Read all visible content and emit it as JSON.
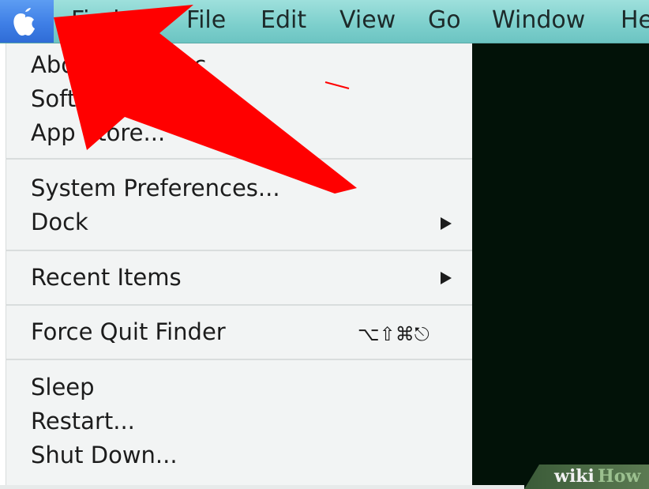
{
  "menubar": {
    "apple_icon": "apple-logo-icon",
    "items": [
      "Finder",
      "File",
      "Edit",
      "View",
      "Go",
      "Window",
      "He"
    ]
  },
  "dropdown": {
    "group1": [
      "About This Mac",
      "Software Update...",
      "App Store..."
    ],
    "group2": [
      "System Preferences...",
      "Dock"
    ],
    "group3": [
      "Recent Items"
    ],
    "group4": [
      "Force Quit Finder"
    ],
    "force_quit_shortcut": "⌥⇧⌘⎋",
    "group5": [
      "Sleep",
      "Restart...",
      "Shut Down..."
    ],
    "submenu_icon": "submenu-arrow-icon"
  },
  "annotation": {
    "arrow_color": "#ff0000",
    "points_to": "apple-menu-button"
  },
  "watermark": {
    "part1": "wiki",
    "part2": "How"
  },
  "colors": {
    "menubar": "#7ccfcc",
    "apple_highlight": "#3f7fe6",
    "dropdown_bg": "#f2f4f4",
    "desktop_bg": "#021208"
  }
}
